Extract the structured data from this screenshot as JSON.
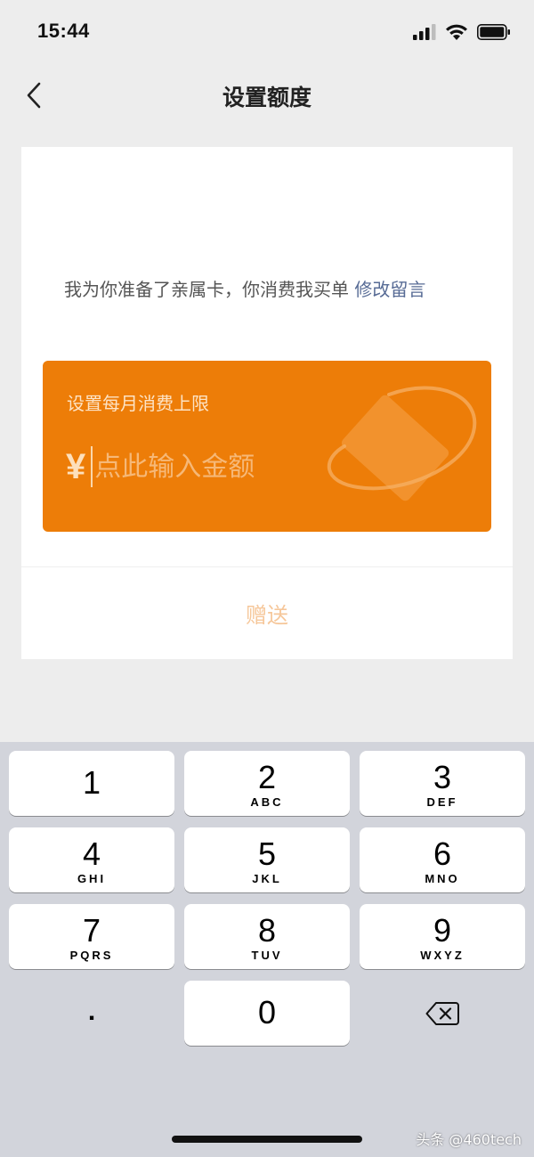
{
  "status_bar": {
    "time": "15:44"
  },
  "nav": {
    "title": "设置额度"
  },
  "message": {
    "text": "我为你准备了亲属卡，你消费我买单",
    "edit_link": "修改留言"
  },
  "amount_card": {
    "label": "设置每月消费上限",
    "currency_symbol": "¥",
    "placeholder": "点此输入金额",
    "value": "",
    "background_color": "#ed7d08"
  },
  "gift_button": {
    "label": "赠送",
    "color": "#f6c79a"
  },
  "keyboard": {
    "keys": [
      {
        "num": "1",
        "letters": ""
      },
      {
        "num": "2",
        "letters": "ABC"
      },
      {
        "num": "3",
        "letters": "DEF"
      },
      {
        "num": "4",
        "letters": "GHI"
      },
      {
        "num": "5",
        "letters": "JKL"
      },
      {
        "num": "6",
        "letters": "MNO"
      },
      {
        "num": "7",
        "letters": "PQRS"
      },
      {
        "num": "8",
        "letters": "TUV"
      },
      {
        "num": "9",
        "letters": "WXYZ"
      },
      {
        "num": "0",
        "letters": ""
      }
    ],
    "decimal": ".",
    "delete_icon": "backspace-icon"
  },
  "watermark": "头条 @460tech",
  "icons": {
    "signal": "cellular-signal-icon",
    "wifi": "wifi-icon",
    "battery": "battery-icon",
    "back": "chevron-left-icon"
  }
}
